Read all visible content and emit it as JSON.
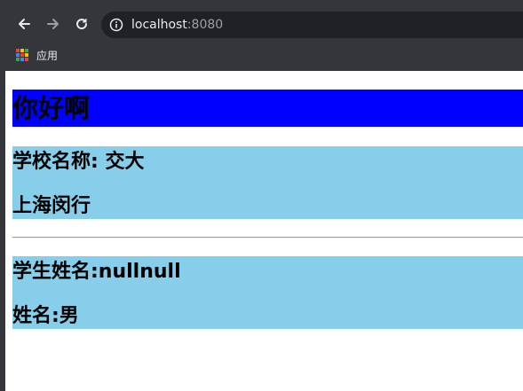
{
  "browser": {
    "url_host": "localhost",
    "url_port": ":8080",
    "bookmarks": {
      "apps_label": "应用",
      "apps_icon": "apps-grid-icon",
      "apps_colors": [
        "#ea4335",
        "#fbbc05",
        "#34a853",
        "#4285f4",
        "#ea4335",
        "#fbbc05",
        "#34a853",
        "#4285f4",
        "#ea4335"
      ]
    },
    "icons": {
      "back": "back-arrow-icon",
      "forward": "forward-arrow-icon",
      "reload": "reload-icon",
      "site_info": "info-icon"
    },
    "chrome_color": "#35363a",
    "omnibox_color": "#202124"
  },
  "page": {
    "heading": "你好啊",
    "heading_bg": "#0000ff",
    "block_bg": "#87ceeb",
    "school": {
      "name_line": "学校名称: 交大",
      "address_line": "上海闵行"
    },
    "student": {
      "name_line": "学生姓名:nullnull",
      "gender_line": "姓名:男"
    }
  }
}
